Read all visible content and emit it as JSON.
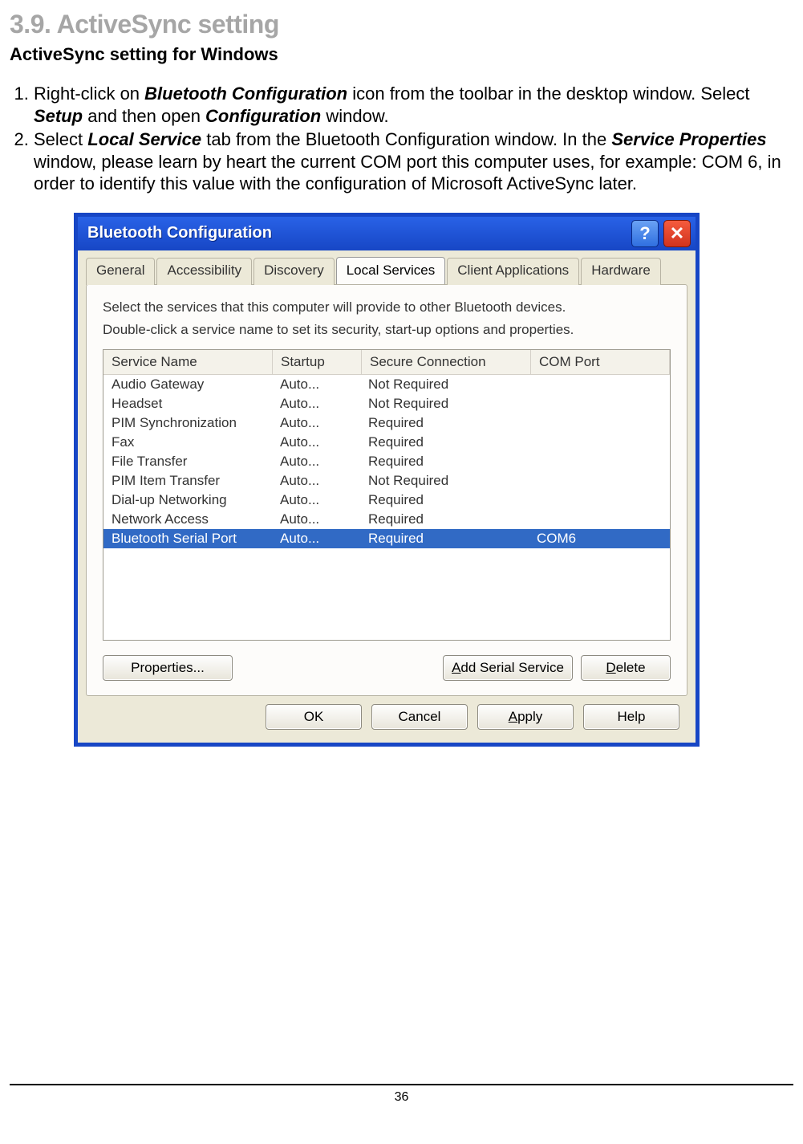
{
  "heading": "3.9. ActiveSync setting",
  "subheading": "ActiveSync setting for Windows",
  "steps": {
    "s1": {
      "pre": "Right-click on ",
      "b1": "Bluetooth Configuration",
      "mid1": " icon from the toolbar in the desktop window. Select ",
      "b2": "Setup",
      "mid2": " and then open ",
      "b3": "Configuration",
      "post": " window."
    },
    "s2": {
      "pre": "Select ",
      "b1": "Local Service",
      "mid1": " tab from the Bluetooth Configuration window. In the ",
      "b2": "Service Properties",
      "post": " window, please learn by heart the current COM port this computer uses, for example: COM 6, in order to identify this value with the configuration of Microsoft ActiveSync later."
    }
  },
  "dialog": {
    "title": "Bluetooth Configuration",
    "help_btn_icon": "?",
    "close_btn_icon": "✕",
    "tabs": [
      "General",
      "Accessibility",
      "Discovery",
      "Local Services",
      "Client Applications",
      "Hardware"
    ],
    "active_tab_index": 3,
    "desc1": "Select the services that this computer will provide to other Bluetooth devices.",
    "desc2": "Double-click a service name to set its security, start-up options and properties.",
    "columns": [
      "Service Name",
      "Startup",
      "Secure Connection",
      "COM Port"
    ],
    "rows": [
      {
        "name": "Audio Gateway",
        "startup": "Auto...",
        "secure": "Not Required",
        "com": ""
      },
      {
        "name": "Headset",
        "startup": "Auto...",
        "secure": "Not Required",
        "com": ""
      },
      {
        "name": "PIM Synchronization",
        "startup": "Auto...",
        "secure": "Required",
        "com": ""
      },
      {
        "name": "Fax",
        "startup": "Auto...",
        "secure": "Required",
        "com": ""
      },
      {
        "name": "File Transfer",
        "startup": "Auto...",
        "secure": "Required",
        "com": ""
      },
      {
        "name": "PIM Item Transfer",
        "startup": "Auto...",
        "secure": "Not Required",
        "com": ""
      },
      {
        "name": "Dial-up Networking",
        "startup": "Auto...",
        "secure": "Required",
        "com": ""
      },
      {
        "name": "Network Access",
        "startup": "Auto...",
        "secure": "Required",
        "com": ""
      },
      {
        "name": "Bluetooth Serial Port",
        "startup": "Auto...",
        "secure": "Required",
        "com": "COM6",
        "selected": true
      }
    ],
    "btn_properties": "Properties...",
    "btn_add_pre": "A",
    "btn_add_rest": "dd Serial Service",
    "btn_delete_pre": "D",
    "btn_delete_rest": "elete",
    "btn_ok": "OK",
    "btn_cancel": "Cancel",
    "btn_apply_pre": "A",
    "btn_apply_rest": "pply",
    "btn_help": "Help"
  },
  "pagenum": "36"
}
